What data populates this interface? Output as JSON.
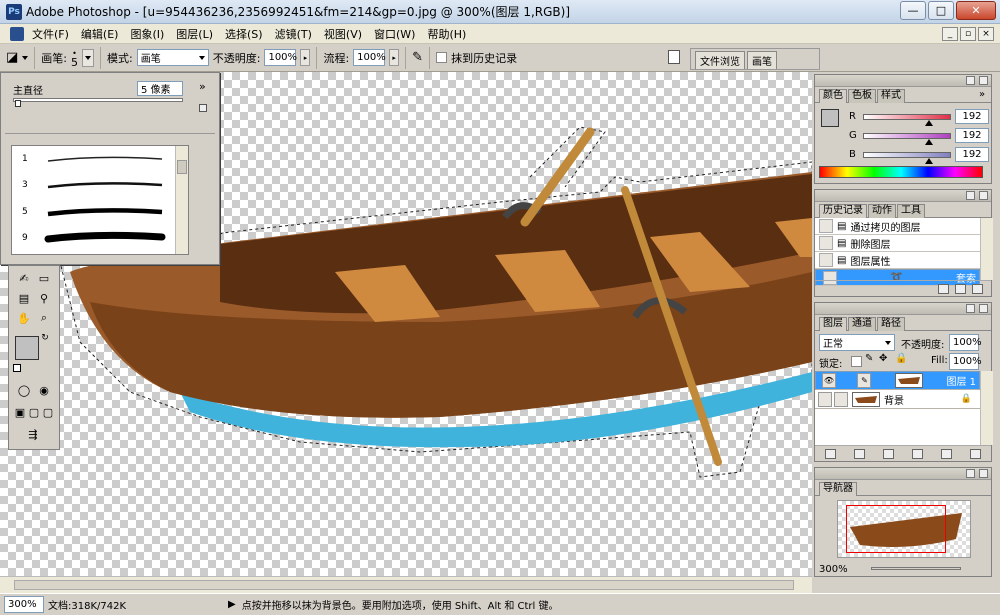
{
  "window": {
    "title": "Adobe Photoshop - [u=954436236,2356992451&fm=214&gp=0.jpg @ 300%(图层 1,RGB)]",
    "app_icon": "Ps"
  },
  "window_buttons": {
    "minimize": "—",
    "maximize": "□",
    "close": "✕"
  },
  "menu": [
    "文件(F)",
    "编辑(E)",
    "图象(I)",
    "图层(L)",
    "选择(S)",
    "滤镜(T)",
    "视图(V)",
    "窗口(W)",
    "帮助(H)"
  ],
  "options": {
    "brush_label": "画笔:",
    "brush_size": "5",
    "mode_label": "模式:",
    "mode_value": "画笔",
    "opacity_label": "不透明度:",
    "opacity_value": "100%",
    "flow_label": "流程:",
    "flow_value": "100%",
    "erase_history_label": "抹到历史记录"
  },
  "panel_well": {
    "tabs": [
      "文件浏览",
      "画笔"
    ]
  },
  "brush_popup": {
    "master_diameter_label": "主直径",
    "master_diameter_value": "5 像素",
    "presets": [
      {
        "size": "1"
      },
      {
        "size": "3"
      },
      {
        "size": "5"
      },
      {
        "size": "9"
      }
    ]
  },
  "color_panel": {
    "tabs": [
      "颜色",
      "色板",
      "样式"
    ],
    "channels": [
      {
        "name": "R",
        "value": "192",
        "track": "#e0304a",
        "fraction": 0.75
      },
      {
        "name": "G",
        "value": "192",
        "track": "#b040c0",
        "fraction": 0.75
      },
      {
        "name": "B",
        "value": "192",
        "track": "#8080c0",
        "fraction": 0.75
      }
    ],
    "fg_color": "#c0c0c0"
  },
  "history_panel": {
    "tabs": [
      "历史记录",
      "动作",
      "工具"
    ],
    "items": [
      "通过拷贝的图层",
      "删除图层",
      "图层属性",
      "套索"
    ],
    "selected_index": 3
  },
  "layers_panel": {
    "tabs": [
      "图层",
      "通道",
      "路径"
    ],
    "blend_mode": "正常",
    "opacity_label": "不透明度:",
    "opacity_value": "100%",
    "lock_label": "锁定:",
    "fill_label": "Fill:",
    "fill_value": "100%",
    "layers": [
      {
        "name": "图层 1",
        "selected": true,
        "visible": true
      },
      {
        "name": "背景",
        "selected": false,
        "visible": false
      }
    ]
  },
  "navigator_panel": {
    "tabs": [
      "导航器"
    ],
    "zoom": "300%"
  },
  "status": {
    "zoom": "300%",
    "doc_info": "文档:318K/742K",
    "hint": "点按并拖移以抹为背景色。要用附加选项，使用 Shift、Alt 和 Ctrl 键。"
  }
}
